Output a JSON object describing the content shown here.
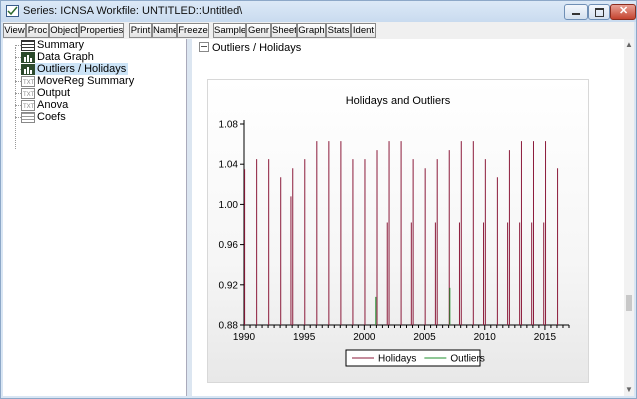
{
  "window": {
    "title": "Series: ICNSA   Workfile: UNTITLED::Untitled\\"
  },
  "toolbar": {
    "buttons": [
      "View",
      "Proc",
      "Object",
      "Properties",
      "Print",
      "Name",
      "Freeze",
      "Sample",
      "Genr",
      "Sheet",
      "Graph",
      "Stats",
      "Ident"
    ]
  },
  "tree": {
    "items": [
      {
        "label": "Summary",
        "icon": "table-icon"
      },
      {
        "label": "Data Graph",
        "icon": "graph-icon"
      },
      {
        "label": "Outliers / Holidays",
        "icon": "graph-icon",
        "selected": true
      },
      {
        "label": "MoveReg Summary",
        "icon": "text-icon"
      },
      {
        "label": "Output",
        "icon": "text-icon"
      },
      {
        "label": "Anova",
        "icon": "text-icon"
      },
      {
        "label": "Coefs",
        "icon": "table-icon"
      }
    ]
  },
  "section": {
    "title": "Outliers / Holidays"
  },
  "chart_data": {
    "type": "bar",
    "title": "Holidays and Outliers",
    "xlabel": "",
    "ylabel": "",
    "ylim": [
      0.88,
      1.08
    ],
    "xlim": [
      1990,
      2017
    ],
    "y_ticks": [
      "0.88",
      "0.92",
      "0.96",
      "1.00",
      "1.04",
      "1.08"
    ],
    "x_ticks": [
      "1990",
      "1995",
      "2000",
      "2005",
      "2010",
      "2015"
    ],
    "grid": false,
    "legend": "bottom",
    "series": [
      {
        "name": "Holidays",
        "color": "#8b1a3a",
        "points": [
          [
            1990.05,
            1.035
          ],
          [
            1991.05,
            1.045
          ],
          [
            1992.05,
            1.045
          ],
          [
            1993.05,
            1.027
          ],
          [
            1993.9,
            1.008
          ],
          [
            1994.05,
            1.036
          ],
          [
            1995.05,
            1.045
          ],
          [
            1996.05,
            1.063
          ],
          [
            1997.05,
            1.063
          ],
          [
            1998.05,
            1.063
          ],
          [
            1999.05,
            1.045
          ],
          [
            2000.05,
            1.045
          ],
          [
            2001.05,
            1.054
          ],
          [
            2001.9,
            0.982
          ],
          [
            2002.05,
            1.063
          ],
          [
            2003.05,
            1.063
          ],
          [
            2003.9,
            0.982
          ],
          [
            2004.05,
            1.045
          ],
          [
            2005.05,
            1.036
          ],
          [
            2005.9,
            0.982
          ],
          [
            2006.05,
            1.045
          ],
          [
            2007.05,
            1.054
          ],
          [
            2007.9,
            0.982
          ],
          [
            2008.05,
            1.063
          ],
          [
            2009.05,
            1.063
          ],
          [
            2009.9,
            0.982
          ],
          [
            2010.05,
            1.045
          ],
          [
            2011.05,
            1.027
          ],
          [
            2011.9,
            0.982
          ],
          [
            2012.05,
            1.054
          ],
          [
            2012.9,
            0.982
          ],
          [
            2013.05,
            1.063
          ],
          [
            2013.9,
            0.982
          ],
          [
            2014.05,
            1.063
          ],
          [
            2014.9,
            0.982
          ],
          [
            2015.05,
            1.063
          ],
          [
            2016.05,
            1.036
          ]
        ]
      },
      {
        "name": "Outliers",
        "color": "#1f8f2e",
        "points": [
          [
            2000.95,
            0.908
          ],
          [
            2007.1,
            0.917
          ]
        ]
      }
    ]
  }
}
